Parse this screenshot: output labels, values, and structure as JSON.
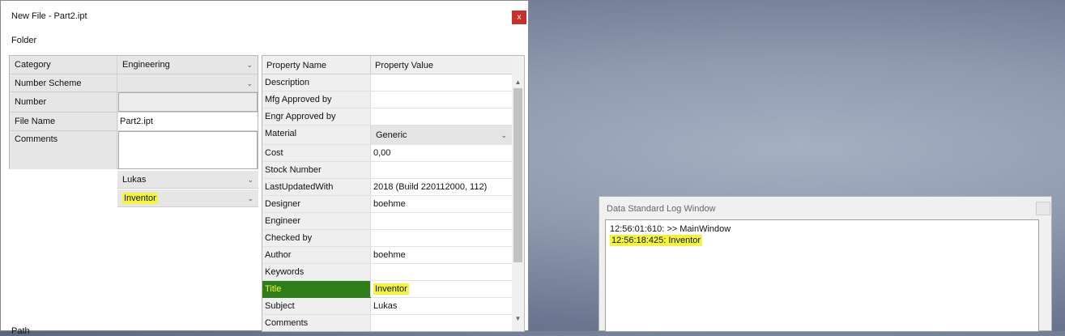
{
  "new_file_window": {
    "title": "New File - Part2.ipt",
    "close_label": "x",
    "folder_label": "Folder",
    "fields": [
      {
        "label": "Category",
        "value": "Engineering",
        "type": "dropdown"
      },
      {
        "label": "Number Scheme",
        "value": "",
        "type": "dropdown"
      },
      {
        "label": "Number",
        "value": "",
        "type": "input"
      },
      {
        "label": "File Name",
        "value": "Part2.ipt",
        "type": "input"
      },
      {
        "label": "Comments",
        "value": "",
        "type": "textarea"
      }
    ],
    "user_select": "Lukas",
    "app_select": "Inventor",
    "chevron": "⌄",
    "property_grid": {
      "headers": [
        "Property Name",
        "Property Value"
      ],
      "rows": [
        {
          "name": "Description",
          "value": ""
        },
        {
          "name": "Mfg Approved by",
          "value": ""
        },
        {
          "name": "Engr Approved by",
          "value": ""
        },
        {
          "name": "Material",
          "value": "Generic"
        },
        {
          "name": "Cost",
          "value": "0,00"
        },
        {
          "name": "Stock Number",
          "value": ""
        },
        {
          "name": "LastUpdatedWith",
          "value": "2018 (Build 220112000, 112)"
        },
        {
          "name": "Designer",
          "value": "boehme"
        },
        {
          "name": "Engineer",
          "value": ""
        },
        {
          "name": "Checked by",
          "value": ""
        },
        {
          "name": "Author",
          "value": "boehme"
        },
        {
          "name": "Keywords",
          "value": ""
        },
        {
          "name": "Title",
          "value": "Inventor"
        },
        {
          "name": "Subject",
          "value": "Lukas"
        },
        {
          "name": "Comments",
          "value": ""
        }
      ]
    },
    "paths_label": "Path"
  },
  "log_window": {
    "title": "Data Standard Log Window",
    "lines": [
      "12:56:01:610: >> MainWindow",
      "12:56:18:425: Inventor"
    ]
  },
  "colors": {
    "highlight": "#f4f440",
    "selection": "#2e7d1a",
    "close_red": "#c9302c"
  }
}
